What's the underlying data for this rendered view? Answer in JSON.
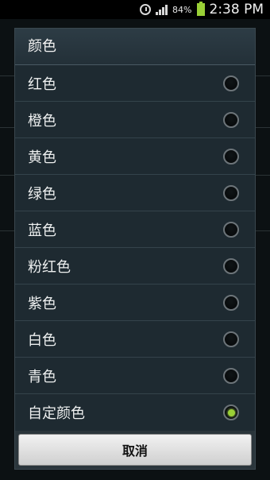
{
  "status_bar": {
    "battery_percent": "84%",
    "time": "2:38 PM",
    "icons": [
      "alarm-icon",
      "signal-icon",
      "battery-icon"
    ],
    "battery_color": "#9ad036"
  },
  "dialog": {
    "title": "颜色",
    "options": [
      {
        "label": "红色",
        "selected": false
      },
      {
        "label": "橙色",
        "selected": false
      },
      {
        "label": "黄色",
        "selected": false
      },
      {
        "label": "绿色",
        "selected": false
      },
      {
        "label": "蓝色",
        "selected": false
      },
      {
        "label": "粉红色",
        "selected": false
      },
      {
        "label": "紫色",
        "selected": false
      },
      {
        "label": "白色",
        "selected": false
      },
      {
        "label": "青色",
        "selected": false
      },
      {
        "label": "自定颜色",
        "selected": true
      }
    ],
    "cancel_label": "取消",
    "accent_color": "#9ad036"
  }
}
